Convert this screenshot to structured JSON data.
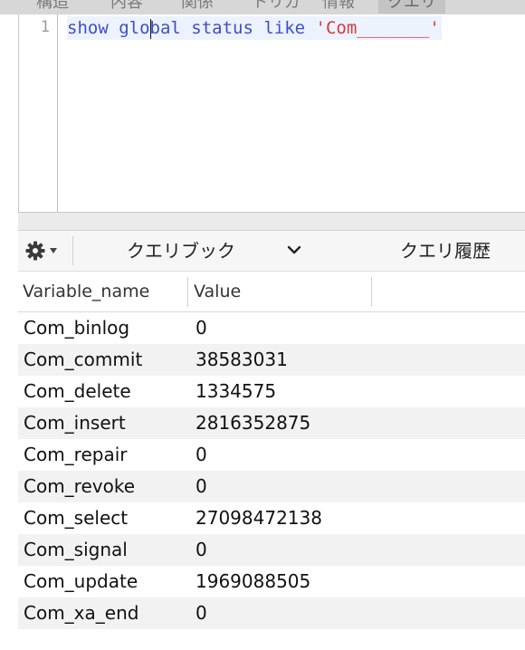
{
  "tabs": [
    {
      "label": "構造",
      "active": false
    },
    {
      "label": "内容",
      "active": false
    },
    {
      "label": "関係",
      "active": false
    },
    {
      "label": "トリガ",
      "active": false
    },
    {
      "label": "情報",
      "active": false
    },
    {
      "label": "クエリ",
      "active": true
    }
  ],
  "editor": {
    "line_number": "1",
    "code_tokens": [
      {
        "text": "show glo",
        "kind": "keyword"
      },
      {
        "text": "bal status like ",
        "kind": "keyword"
      },
      {
        "text": "'Com_______'",
        "kind": "string"
      }
    ]
  },
  "toolbar": {
    "gear_icon": "gear-icon",
    "saved_queries_label": "クエリブック",
    "history_label": "クエリ履歴"
  },
  "results": {
    "columns": [
      "Variable_name",
      "Value"
    ],
    "rows": [
      [
        "Com_binlog",
        "0"
      ],
      [
        "Com_commit",
        "38583031"
      ],
      [
        "Com_delete",
        "1334575"
      ],
      [
        "Com_insert",
        "2816352875"
      ],
      [
        "Com_repair",
        "0"
      ],
      [
        "Com_revoke",
        "0"
      ],
      [
        "Com_select",
        "27098472138"
      ],
      [
        "Com_signal",
        "0"
      ],
      [
        "Com_update",
        "1969088505"
      ],
      [
        "Com_xa_end",
        "0"
      ]
    ]
  },
  "colors": {
    "keyword": "#3b4fcb",
    "string": "#d63a3a",
    "row_alt": "#f2f2f2"
  }
}
